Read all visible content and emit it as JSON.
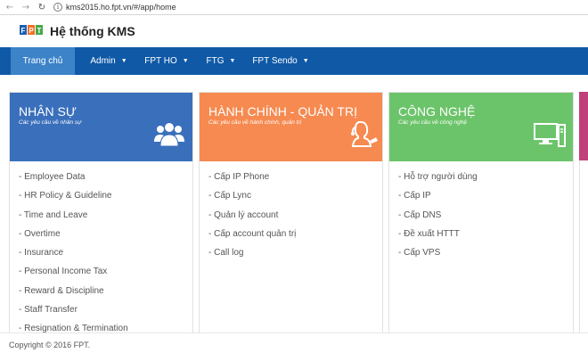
{
  "browser": {
    "url": "kms2015.ho.fpt.vn/#/app/home"
  },
  "header": {
    "title": "Hệ thống KMS",
    "logo_text": "FPT"
  },
  "nav": {
    "items": [
      {
        "label": "Trang chủ",
        "active": true
      },
      {
        "label": "Admin",
        "has_dropdown": true
      },
      {
        "label": "FPT HO",
        "has_dropdown": true
      },
      {
        "label": "FTG",
        "has_dropdown": true
      },
      {
        "label": "FPT Sendo",
        "has_dropdown": true
      }
    ]
  },
  "cards": [
    {
      "title": "NHÂN SỰ",
      "subtitle": "Các yêu cầu về nhân sự",
      "color": "#3a6fbb",
      "icon": "people-icon",
      "items": [
        "- Employee Data",
        "- HR Policy & Guideline",
        "- Time and Leave",
        "- Overtime",
        "- Insurance",
        "- Personal Income Tax",
        "- Reward & Discipline",
        "- Staff Transfer",
        "- Resignation & Termination"
      ]
    },
    {
      "title": "HÀNH CHÍNH - QUẢN TRỊ",
      "subtitle": "Các yêu cầu về hành chính, quản trị",
      "color": "#f68a50",
      "icon": "receptionist-icon",
      "items": [
        "- Cấp IP Phone",
        "- Cấp Lync",
        "- Quản lý account",
        "- Cấp account quản trị",
        "- Call log"
      ]
    },
    {
      "title": "CÔNG NGHỆ",
      "subtitle": "Các yêu cầu về công nghệ",
      "color": "#6cc46a",
      "icon": "computer-icon",
      "items": [
        "- Hỗ trợ người dùng",
        "- Cấp IP",
        "- Cấp DNS",
        "- Đề xuất HTTT",
        "- Cấp VPS"
      ]
    }
  ],
  "footer": {
    "copyright": "Copyright © 2016 FPT."
  }
}
